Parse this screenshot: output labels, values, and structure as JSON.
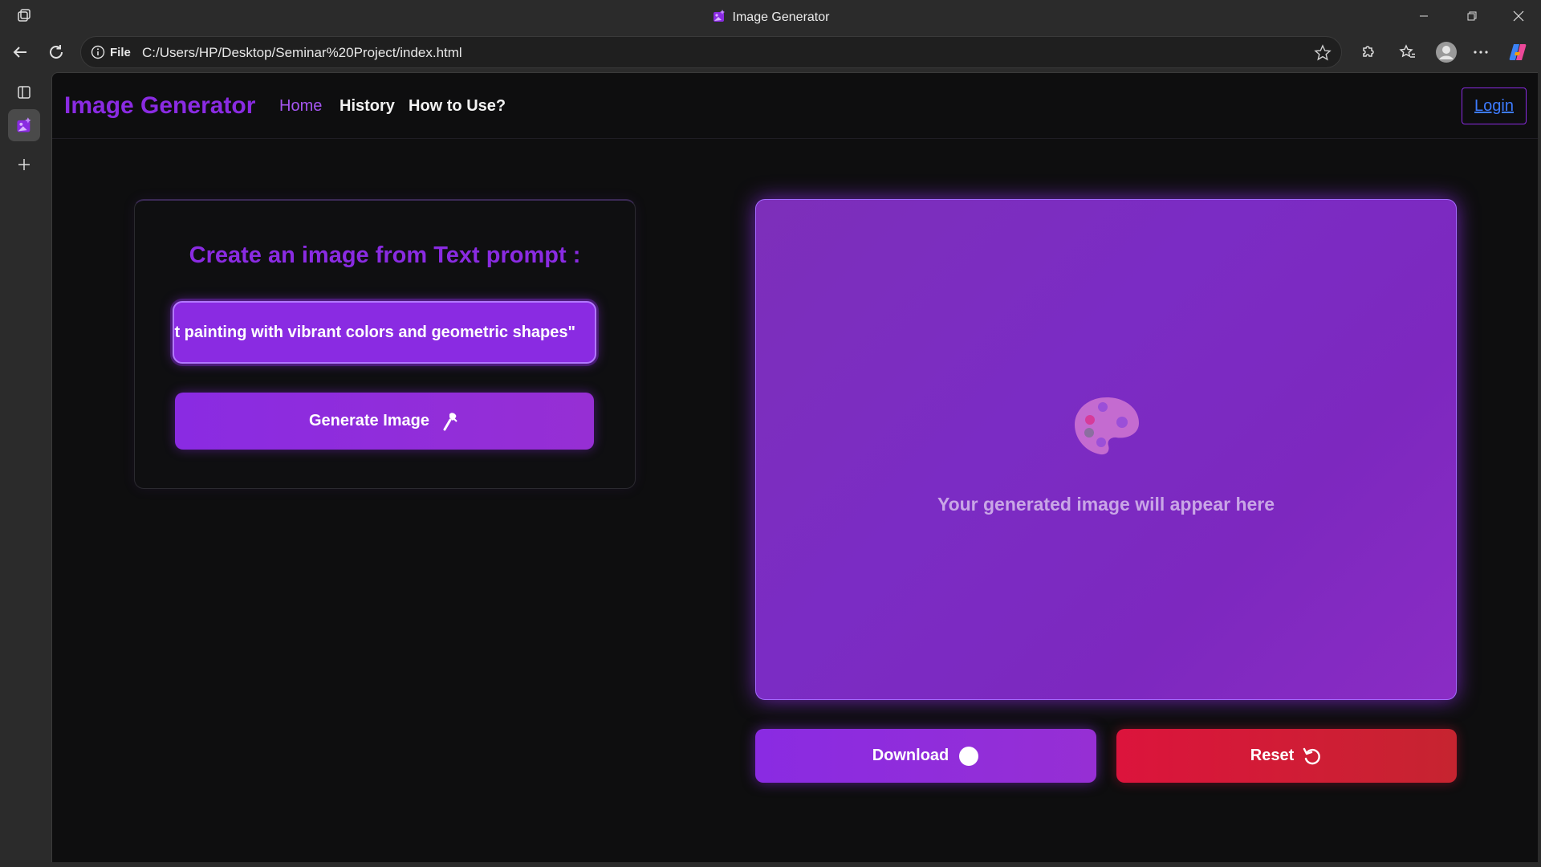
{
  "browser": {
    "window_title": "Image Generator",
    "address_scheme_label": "File",
    "url": "C:/Users/HP/Desktop/Seminar%20Project/index.html"
  },
  "page": {
    "brand": "Image Generator",
    "nav": {
      "home": "Home",
      "history": "History",
      "how_to_use": "How to Use?",
      "login": "Login"
    },
    "card": {
      "title": "Create an image from Text prompt :",
      "prompt_value": "t painting with vibrant colors and geometric shapes\"",
      "generate_label": "Generate Image"
    },
    "preview": {
      "placeholder_text": "Your generated image will appear here"
    },
    "actions": {
      "download_label": "Download",
      "reset_label": "Reset"
    }
  },
  "colors": {
    "accent": "#8a2be2",
    "danger": "#dc143c",
    "background": "#0e0e0f"
  },
  "icons": [
    "tabs-icon",
    "image-favicon-icon",
    "add-tab-icon",
    "back-arrow-icon",
    "refresh-icon",
    "info-icon",
    "star-icon",
    "extensions-icon",
    "favorites-icon",
    "profile-icon",
    "more-icon",
    "copilot-icon",
    "wand-icon",
    "palette-icon",
    "download-circle-icon",
    "reset-icon"
  ]
}
